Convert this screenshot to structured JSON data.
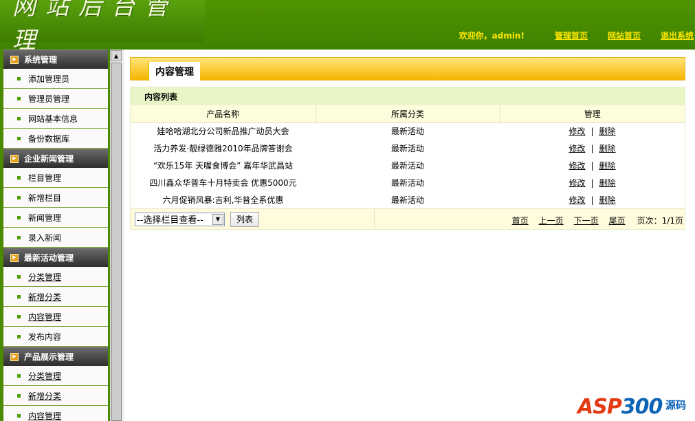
{
  "header": {
    "logo_text": "网站后台管理",
    "welcome": "欢迎你，admin!",
    "links": [
      "管理首页",
      "网站首页",
      "退出系统"
    ]
  },
  "sidebar": {
    "sections": [
      {
        "title": "系统管理",
        "items": [
          "添加管理员",
          "管理员管理",
          "网站基本信息",
          "备份数据库"
        ]
      },
      {
        "title": "企业新闻管理",
        "items": [
          "栏目管理",
          "新增栏目",
          "新闻管理",
          "录入新闻"
        ]
      },
      {
        "title": "最新活动管理",
        "items": [
          "分类管理",
          "新增分类",
          "内容管理",
          "发布内容"
        ]
      },
      {
        "title": "产品展示管理",
        "items": [
          "分类管理",
          "新增分类",
          "内容管理"
        ]
      }
    ]
  },
  "main": {
    "tab_label": "内容管理",
    "panel_title": "内容列表",
    "columns": [
      "产品名称",
      "所属分类",
      "管理"
    ],
    "rows": [
      {
        "name": "娃哈哈湖北分公司新品推广动员大会",
        "category": "最新活动"
      },
      {
        "name": "活力养发·靓绿德雅2010年品牌答谢会",
        "category": "最新活动"
      },
      {
        "name": "“欢乐15年 天喔食博会” 嘉年华武昌站",
        "category": "最新活动"
      },
      {
        "name": "四川鑫众华普车十月特卖会 优惠5000元",
        "category": "最新活动"
      },
      {
        "name": "六月促销风暴:吉利,华普全系优惠",
        "category": "最新活动"
      }
    ],
    "action_edit": "修改",
    "action_sep": "|",
    "action_delete": "删除",
    "select_value": "--选择栏目查看--",
    "list_button": "列表",
    "pager": {
      "first": "首页",
      "prev": "上一页",
      "next": "下一页",
      "last": "尾页",
      "page_info": "页次：1/1页"
    }
  },
  "watermark": {
    "asp": "ASP",
    "num": "300",
    "cn": "源码"
  },
  "colors": {
    "header_green": "#4f9400",
    "link_yellow": "#ffe600",
    "tab_orange": "#f6b400"
  }
}
